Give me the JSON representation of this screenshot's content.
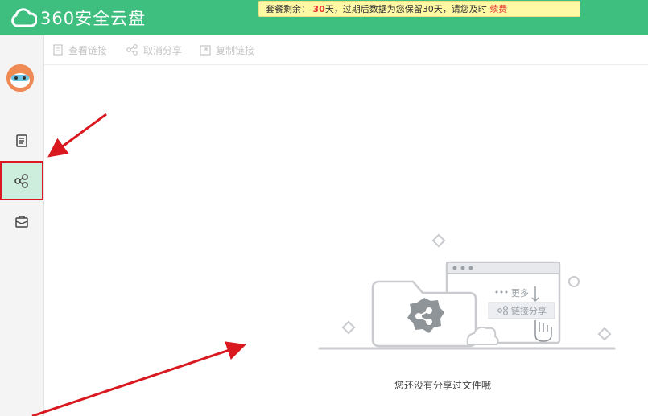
{
  "app": {
    "title": "360安全云盘"
  },
  "notice": {
    "prefix": "套餐剩余：",
    "days": "30",
    "days_unit": "天",
    "message": "，过期后数据为您保留30天，请您及时",
    "renew_link": "续费"
  },
  "sidebar": {
    "items": [
      {
        "name": "files",
        "icon": "file-list-icon"
      },
      {
        "name": "share",
        "icon": "share-icon",
        "active": true
      },
      {
        "name": "toolbox",
        "icon": "toolbox-icon"
      }
    ]
  },
  "toolbar": {
    "view_link": "查看链接",
    "cancel_share": "取消分享",
    "copy_link": "复制链接"
  },
  "illustration": {
    "more_label": "更多",
    "share_link_label": "链接分享"
  },
  "empty_state": {
    "message": "您还没有分享过文件哦"
  },
  "colors": {
    "brand": "#3fbf7f",
    "active_bg": "#cdeedd",
    "annotation_red": "#d9181f",
    "notice_bg": "#fff9a6"
  }
}
